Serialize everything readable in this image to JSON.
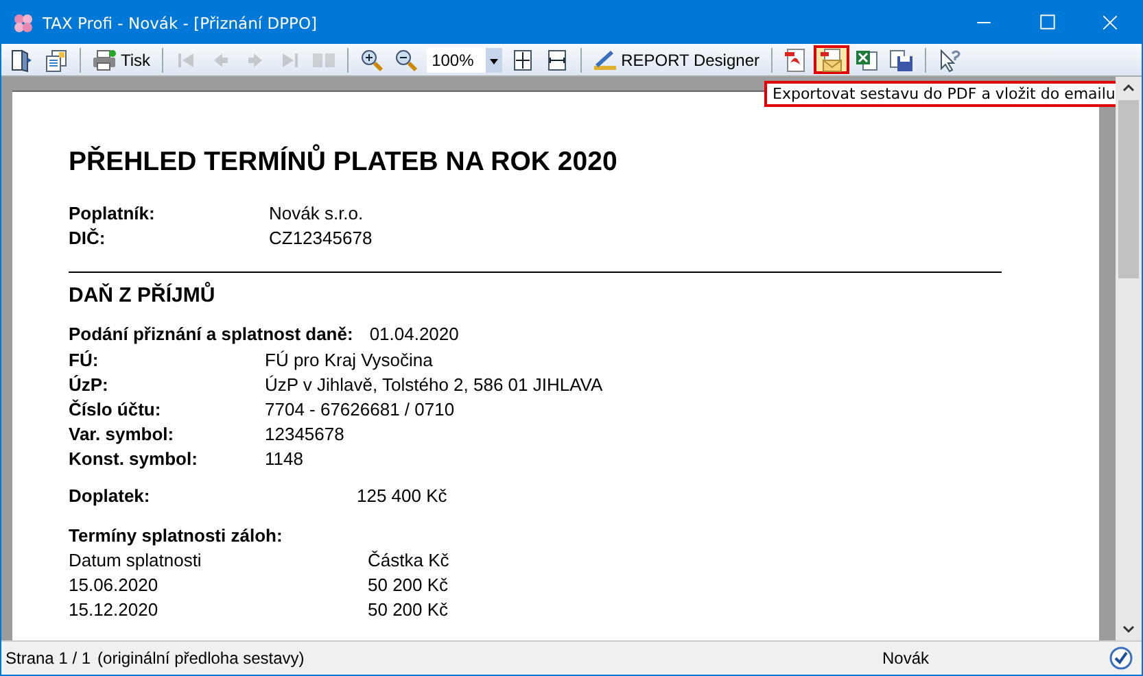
{
  "window": {
    "title": "TAX Profi - Novák - [Přiznání DPPO]"
  },
  "toolbar": {
    "tools": [
      {
        "disabled": false,
        "highlighted": false
      },
      {
        "disabled": false,
        "highlighted": false
      },
      {
        "label": "Tisk",
        "disabled": false,
        "highlighted": false
      },
      {
        "disabled": true,
        "highlighted": false
      },
      {
        "disabled": true,
        "highlighted": false
      },
      {
        "disabled": true,
        "highlighted": false
      },
      {
        "disabled": true,
        "highlighted": false
      },
      {
        "disabled": true,
        "highlighted": false
      },
      {
        "disabled": false,
        "highlighted": false
      },
      {
        "disabled": false,
        "highlighted": false
      },
      {
        "value": "100%",
        "disabled": false,
        "highlighted": false
      },
      {
        "disabled": false,
        "highlighted": false
      },
      {
        "disabled": false,
        "highlighted": false
      },
      {
        "label": "REPORT Designer",
        "disabled": false,
        "highlighted": false
      },
      {
        "disabled": false,
        "highlighted": false
      },
      {
        "disabled": false,
        "highlighted": true
      },
      {
        "disabled": false,
        "highlighted": false
      },
      {
        "disabled": false,
        "highlighted": false
      },
      {
        "disabled": false,
        "highlighted": false
      }
    ],
    "tooltip": "Exportovat sestavu do PDF a vložit do emailu"
  },
  "report": {
    "title": "PŘEHLED TERMÍNŮ PLATEB NA ROK 2020",
    "taxpayer": [
      {
        "label": "Poplatník:",
        "value": "Novák s.r.o."
      },
      {
        "label": "DIČ:",
        "value": "CZ12345678"
      }
    ],
    "section": "DAŇ Z PŘÍJMŮ",
    "due": {
      "label": "Podání přiznání a splatnost daně:",
      "value": "01.04.2020"
    },
    "payment": [
      {
        "label": "FÚ:",
        "value": "FÚ pro Kraj Vysočina"
      },
      {
        "label": "ÚzP:",
        "value": "ÚzP v Jihlavě, Tolstého 2, 586 01 JIHLAVA"
      },
      {
        "label": "Číslo účtu:",
        "value": "7704 - 67626681 / 0710"
      },
      {
        "label": "Var. symbol:",
        "value": "12345678"
      },
      {
        "label": "Konst. symbol:",
        "value": "1148"
      }
    ],
    "surcharge": {
      "label": "Doplatek:",
      "value": "125 400 Kč"
    },
    "advances": {
      "title": "Termíny splatnosti záloh:",
      "columns": [
        "Datum splatnosti",
        "Částka Kč"
      ],
      "rows": [
        [
          "15.06.2020",
          "50 200 Kč"
        ],
        [
          "15.12.2020",
          "50 200 Kč"
        ]
      ]
    }
  },
  "status_bar": {
    "page": "Strana 1 / 1",
    "template": "(originální předloha sestavy)",
    "user": "Novák"
  }
}
